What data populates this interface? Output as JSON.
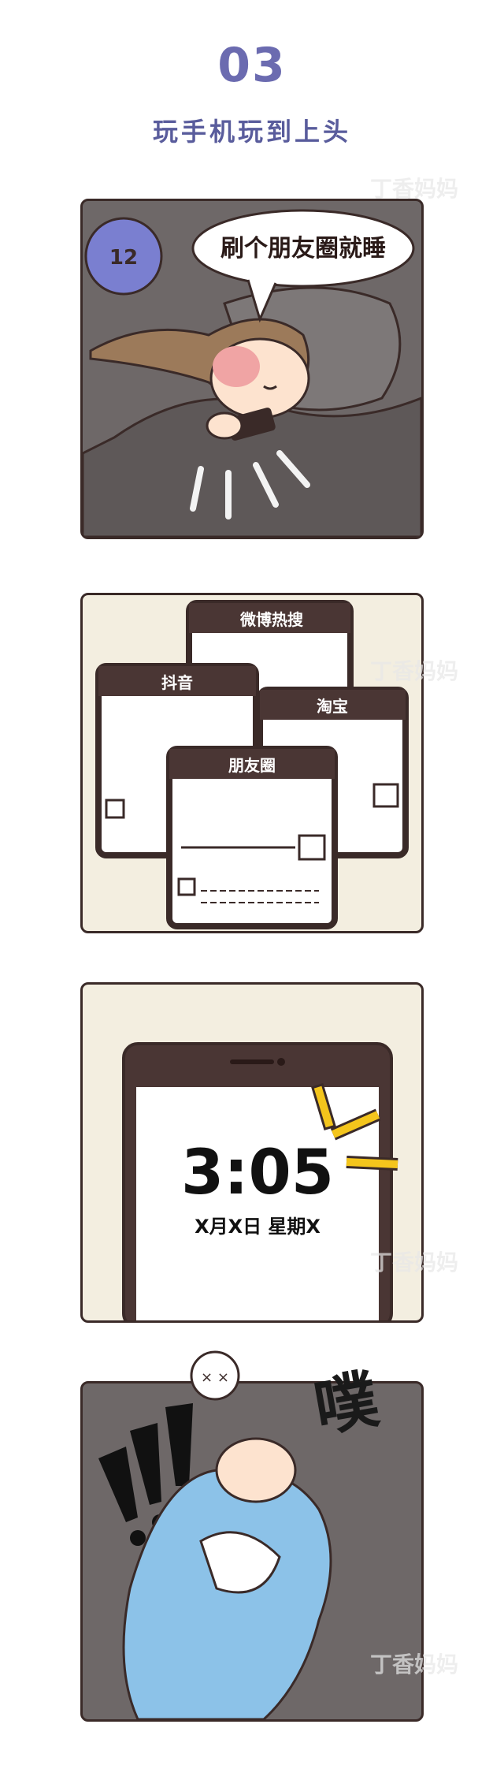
{
  "header": {
    "number": "03",
    "title": "玩手机玩到上头"
  },
  "panel1": {
    "speech": "刷个朋友圈就睡",
    "clock_label": "12"
  },
  "panel2": {
    "apps": [
      "微博热搜",
      "抖音",
      "淘宝",
      "朋友圈"
    ]
  },
  "panel3": {
    "time": "3:05",
    "date": "X月X日  星期X"
  },
  "panel4": {
    "shout": "!!!",
    "sfx": "噗"
  },
  "watermark": "丁香妈妈",
  "colors": {
    "accent": "#6b6bb0",
    "panel_bg_dark": "#6e6868",
    "panel_bg_light": "#f3eee0",
    "outline": "#3a2a28",
    "alarm_yellow": "#f4c51c",
    "character_blue": "#8cc2e8"
  }
}
